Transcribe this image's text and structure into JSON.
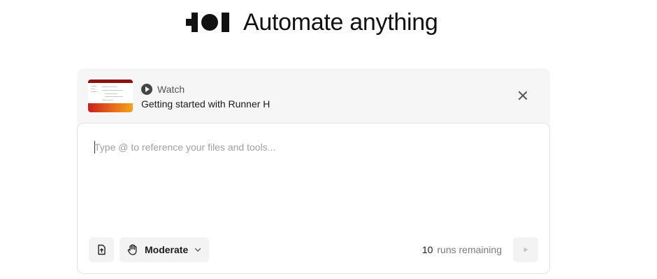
{
  "header": {
    "logo_icon": "runner-h-logo",
    "title": "Automate anything"
  },
  "promo": {
    "watch_label": "Watch",
    "video_title": "Getting started with Runner H",
    "play_icon": "play-circle-icon",
    "close_icon": "close-icon",
    "thumbnail_colors": [
      "#8c1212",
      "#c8201c",
      "#f2a51c"
    ]
  },
  "composer": {
    "placeholder": "Type @ to reference your files and tools...",
    "value": "",
    "attach_icon": "file-upload-icon",
    "mode": {
      "icon": "hand-icon",
      "label": "Moderate",
      "chevron_icon": "chevron-down-icon"
    },
    "runs": {
      "count": "10",
      "label": "runs remaining"
    },
    "send_icon": "send-play-icon"
  }
}
